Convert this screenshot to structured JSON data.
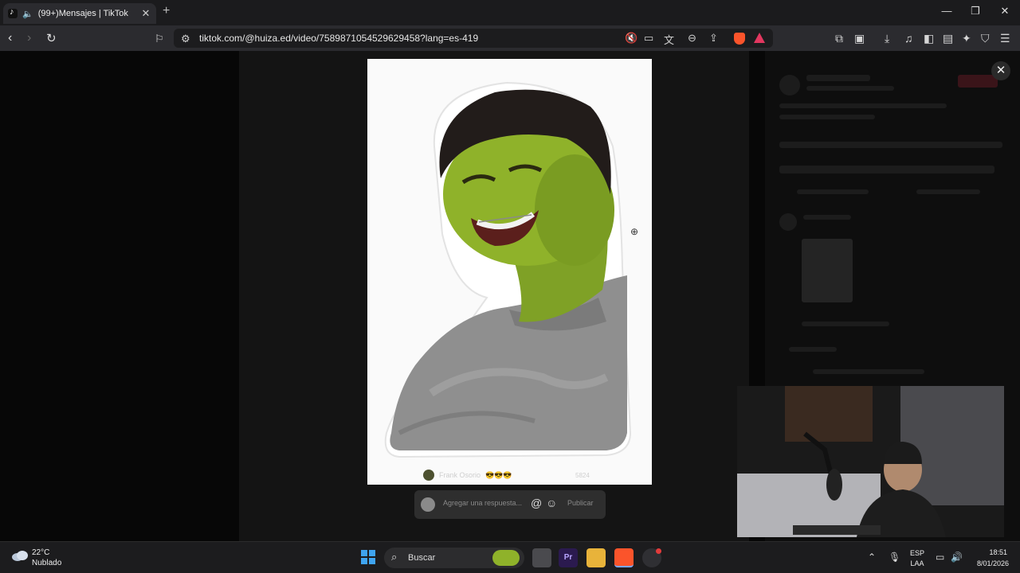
{
  "browser": {
    "tab": {
      "title": "(99+)Mensajes | TikTok",
      "audio_icon": "speaker-icon",
      "close": "✕"
    },
    "new_tab": "+",
    "window": {
      "minimize": "—",
      "maximize": "❐",
      "close": "✕"
    },
    "url": "tiktok.com/@huiza.ed/video/7589871054529629458?lang=es-419"
  },
  "page": {
    "modal_close": "✕",
    "image_card": {
      "author": "Frank Osorio",
      "reaction": "😎😎😎",
      "timestamp": "5824"
    },
    "reply": {
      "placeholder": "Agregar una respuesta...",
      "at": "@",
      "emoji": "☺",
      "post_label": "Publicar"
    }
  },
  "taskbar": {
    "weather": {
      "temp": "22°C",
      "desc": "Nublado"
    },
    "search_label": "Buscar",
    "tray": {
      "lang_top": "ESP",
      "lang_bottom": "LAA",
      "time": "18:51",
      "date": "8/01/2026"
    }
  },
  "colors": {
    "accent_brave": "#fb542b",
    "skin_green": "#8fb22a",
    "card_bg": "#fafafa"
  }
}
